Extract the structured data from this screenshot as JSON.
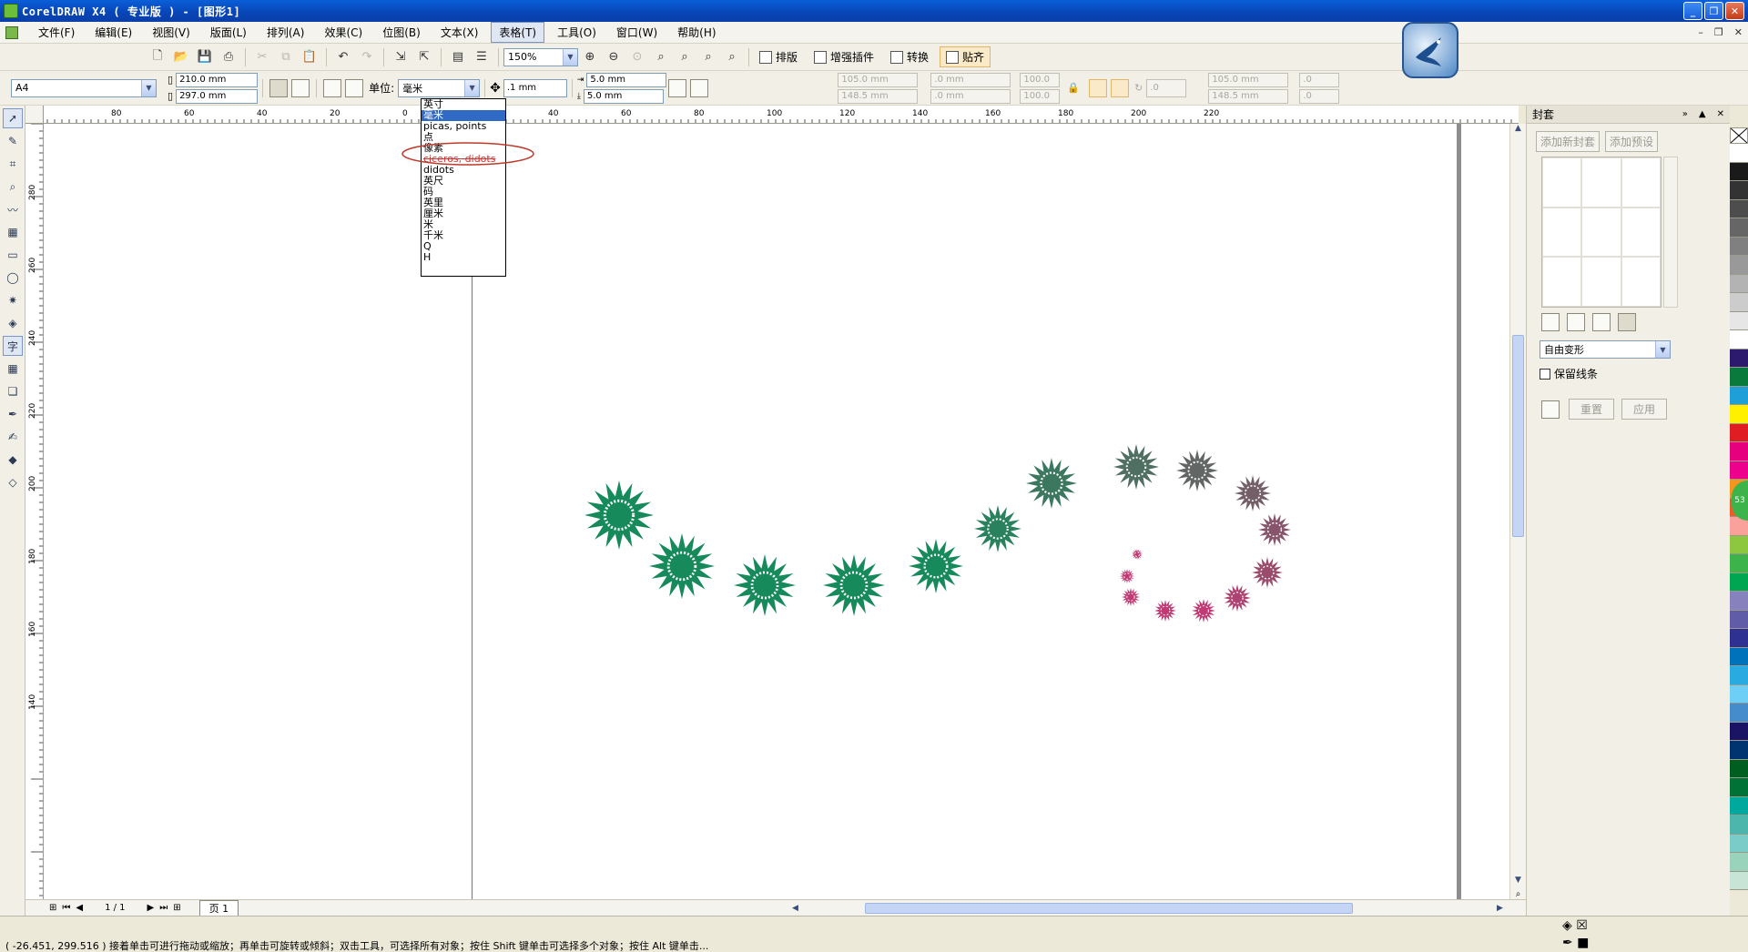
{
  "window": {
    "title": "CorelDRAW X4 ( 专业版 ) - [图形1]"
  },
  "menu": {
    "items": [
      "文件(F)",
      "编辑(E)",
      "视图(V)",
      "版面(L)",
      "排列(A)",
      "效果(C)",
      "位图(B)",
      "文本(X)",
      "表格(T)",
      "工具(O)",
      "窗口(W)",
      "帮助(H)"
    ]
  },
  "toolbar": {
    "zoom": "150%",
    "plugin_buttons": [
      "排版",
      "增强插件",
      "转换",
      "贴齐"
    ]
  },
  "property_bar": {
    "page_size": "A4",
    "width": "210.0 mm",
    "height": "297.0 mm",
    "unit_label": "单位:",
    "unit_value": "毫米",
    "nudge": ".1 mm",
    "dup_x": "5.0 mm",
    "dup_y": "5.0 mm",
    "x": "105.0 mm",
    "y": "148.5 mm",
    "w": ".0 mm",
    "h": ".0 mm",
    "scale_x": "100.0",
    "scale_y": "100.0",
    "angle": ".0",
    "center_x": "105.0 mm",
    "center_y": "148.5 mm",
    "skew_x": ".0",
    "skew_y": ".0"
  },
  "unit_dropdown": {
    "options": [
      "英寸",
      "毫米",
      "picas, points",
      "点",
      "像素",
      "ciceros, didots",
      "didots",
      "英尺",
      "码",
      "英里",
      "厘米",
      "米",
      "千米",
      "Q",
      "H"
    ],
    "selected_index": 1,
    "circled_option": "像素"
  },
  "rulers": {
    "top_labels": [
      "80",
      "60",
      "40",
      "20",
      "0",
      "20",
      "40",
      "60",
      "80",
      "100",
      "120",
      "140",
      "160",
      "180",
      "200",
      "220"
    ],
    "left_labels": [
      "280",
      "260",
      "240",
      "220",
      "200",
      "180",
      "160",
      "140"
    ]
  },
  "pager": {
    "page_count": "1 / 1",
    "page_tab": "页 1"
  },
  "docker": {
    "title": "封套",
    "add_new_button": "添加新封套",
    "add_preset_button": "添加预设",
    "mode_select": "自由变形",
    "keep_lines_label": "保留线条",
    "reset_button": "重置",
    "apply_button": "应用"
  },
  "status": {
    "text": "( -26.451, 299.516 )      接着单击可进行拖动或缩放；再单击可旋转或倾斜；双击工具，可选择所有对象；按住 Shift 键单击可选择多个对象；按住 Alt 键单击..."
  },
  "palette": {
    "colors": [
      "#ffffff",
      "#1a1a1a",
      "#333333",
      "#4d4d4d",
      "#666666",
      "#808080",
      "#999999",
      "#b3b3b3",
      "#cccccc",
      "#e6e6e6",
      "#ffffff",
      "#2b1a6e",
      "#0a7a3c",
      "#1e9fd8",
      "#fff000",
      "#e11d24",
      "#e6007e",
      "#ec008c",
      "#f7941d",
      "#f15a24",
      "#f9a19a",
      "#8dc63f",
      "#3db34b",
      "#00a651",
      "#8781bd",
      "#605ca8",
      "#2e3192",
      "#0072bc",
      "#29abe2",
      "#6dcff6",
      "#448ccb",
      "#1b1464",
      "#003471",
      "#005e20",
      "#007236",
      "#00a99d",
      "#4db6ac",
      "#7accc8",
      "#9ad3bc",
      "#c7e4d6"
    ],
    "accent_green": "#168a5a",
    "accent_pink": "#c03a73"
  }
}
